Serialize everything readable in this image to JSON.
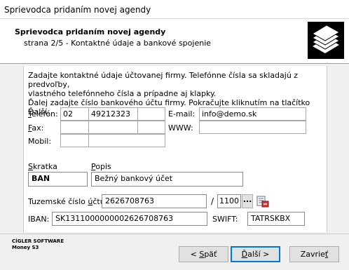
{
  "window": {
    "title": "Sprievodca pridaním novej agendy"
  },
  "header": {
    "title": "Sprievodca pridaním novej agendy",
    "subtitle": "strana 2/5 - Kontaktné údaje a bankové spojenie"
  },
  "intro": {
    "line1": "Zadajte kontaktné údaje účtovanej firmy. Telefónne čísla sa skladajú z predvoľby,",
    "line2": "vlastného telefónneho čísla a prípadne aj klapky.",
    "line3": "Ďalej zadajte číslo bankového účtu firmy. Pokračujte kliknutím na tlačítko Ďalší."
  },
  "phone": {
    "telefon_label_first": "T",
    "telefon_label_rest": "elefón:",
    "telefon_prefix": "02",
    "telefon_number": "49212323",
    "telefon_ext": "",
    "fax_label_first": "F",
    "fax_label_rest": "ax:",
    "mobil_label": "Mobil:"
  },
  "contact": {
    "email_label": "E-mail:",
    "email_value": "info@demo.sk",
    "www_label": "WWW:",
    "www_value": ""
  },
  "bank": {
    "skratka_label_first": "S",
    "skratka_label_rest": "kratka",
    "skratka_value": "BAN",
    "popis_label_first": "P",
    "popis_label_rest": "opis",
    "popis_value": "Bežný bankový účet",
    "account_label_pre": "Tuzemské číslo ",
    "account_label_ul": "ú",
    "account_label_post": "čtu:",
    "account_value": "2626708763",
    "slash": "/",
    "bank_code": "1100",
    "ellipsis_btn": "...",
    "iban_label": "IBAN:",
    "iban_value": "SK1311000000002626708763",
    "swift_label": "SWIFT:",
    "swift_value": "TATRSKBX"
  },
  "footer": {
    "company_line1": "CÍGLER SOFTWARE",
    "company_line2": "Money S3",
    "back_pre": "< ",
    "back_ul": "S",
    "back_post": "päť",
    "next_ul": "Ď",
    "next_post": "alší >",
    "cancel_pre": "Zavrie",
    "cancel_ul": "ť"
  }
}
